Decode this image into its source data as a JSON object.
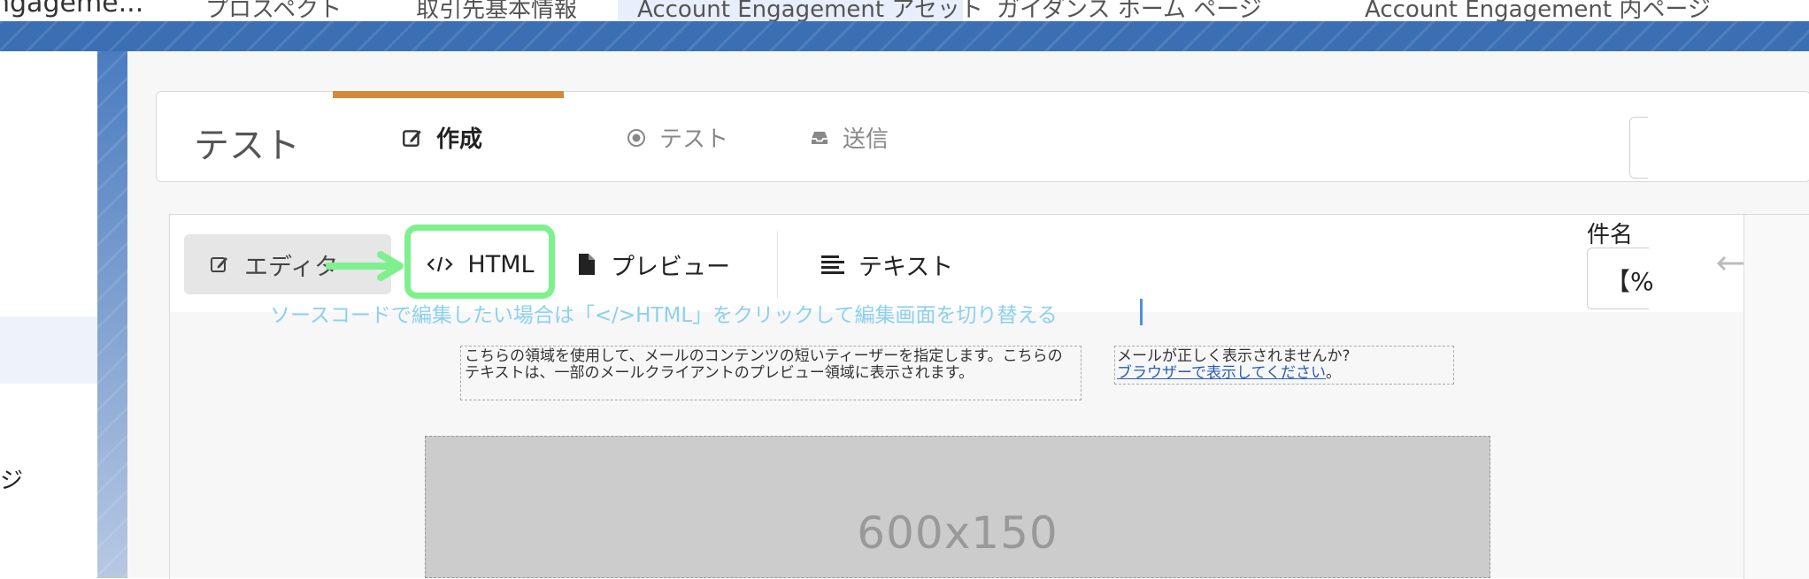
{
  "browser_tabs": [
    {
      "label": "ngageme..."
    },
    {
      "label": "プロスペクト"
    },
    {
      "label": "取引先基本情報"
    },
    {
      "label": "Account Engagement アセット",
      "active": true
    },
    {
      "label": "ガイダンス ホーム ページ"
    },
    {
      "label": "Account Engagement 内ページ"
    }
  ],
  "sidebar": {
    "partial_label": "ジ"
  },
  "header": {
    "title": "テスト",
    "steps": [
      {
        "label": "作成",
        "icon": "edit-icon",
        "active": true
      },
      {
        "label": "テスト",
        "icon": "target-icon",
        "active": false
      },
      {
        "label": "送信",
        "icon": "inbox-icon",
        "active": false
      }
    ]
  },
  "toolbar": {
    "editor_label": "エディター",
    "html_label": "HTML",
    "preview_label": "プレビュー",
    "text_label": "テキスト"
  },
  "annotation": {
    "instruction": "ソースコードで編集したい場合は「</>HTML」をクリックして編集画面を切り替える",
    "highlight_color": "#7ef08e",
    "arrow_color": "#7ef08e"
  },
  "email_body": {
    "preheader": "こちらの領域を使用して、メールのコンテンツの短いティーザーを指定します。こちらのテキストは、一部のメールクライアントのプレビュー領域に表示されます。",
    "view_online_prefix": "メールが正しく表示されませんか?",
    "view_online_link": "ブラウザーで表示してください",
    "view_online_suffix": "。",
    "image_placeholder": "600x150"
  },
  "right_panel": {
    "subject_label": "件名",
    "subject_value": "【%"
  },
  "colors": {
    "brand_blue": "#3b6fb4",
    "active_step_bar": "#d48838",
    "instruction_text": "#8dd0ee"
  }
}
